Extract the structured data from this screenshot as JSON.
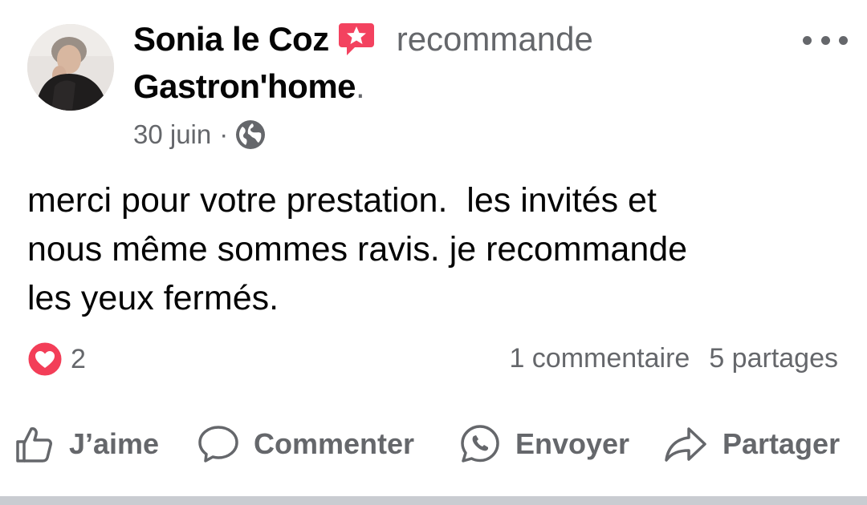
{
  "post": {
    "author": "Sonia le Coz",
    "action": "recommande",
    "page": "Gastron'home",
    "period": ".",
    "date": "30 juin",
    "separator": "·",
    "visibility_icon": "globe-icon",
    "text": "merci pour votre prestation.  les invités et\nnous même sommes ravis. je recommande\nles yeux fermés."
  },
  "reactions": {
    "icon": "heart-reaction-icon",
    "count": "2",
    "comments": "1 commentaire",
    "shares": "5 partages"
  },
  "actions": {
    "like": "J’aime",
    "comment": "Commenter",
    "send": "Envoyer",
    "share": "Partager"
  },
  "colors": {
    "primary_text": "#050505",
    "secondary_text": "#65676b",
    "recommend_badge": "#f3425f",
    "heart": "#f33e58",
    "divider": "#c9ccd1"
  }
}
